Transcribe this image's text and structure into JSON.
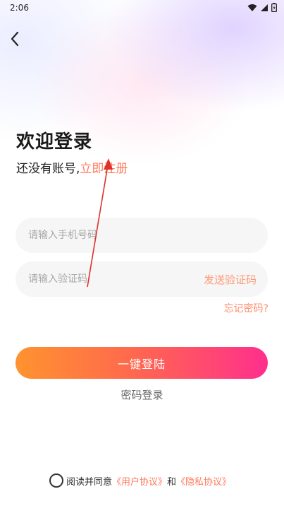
{
  "status_bar": {
    "time": "2:06"
  },
  "header": {
    "back_icon": "chevron-left-icon",
    "title": "欢迎登录",
    "register_prompt": "还没有账号,",
    "register_link": "立即注册"
  },
  "form": {
    "phone_placeholder": "请输入手机号码",
    "code_placeholder": "请输入验证码",
    "send_code_label": "发送验证码",
    "forgot_password_label": "忘记密码?",
    "login_button_label": "一键登陆",
    "password_login_label": "密码登录"
  },
  "agreement": {
    "prefix": "阅读并同意",
    "user_agreement": "《用户协议》",
    "and": "和",
    "privacy_policy": "《隐私协议》"
  },
  "colors": {
    "accent": "#ff7a59",
    "button_gradient_start": "#ff9330",
    "button_gradient_end": "#ff2f8d",
    "annotation_arrow": "#e0302a"
  }
}
